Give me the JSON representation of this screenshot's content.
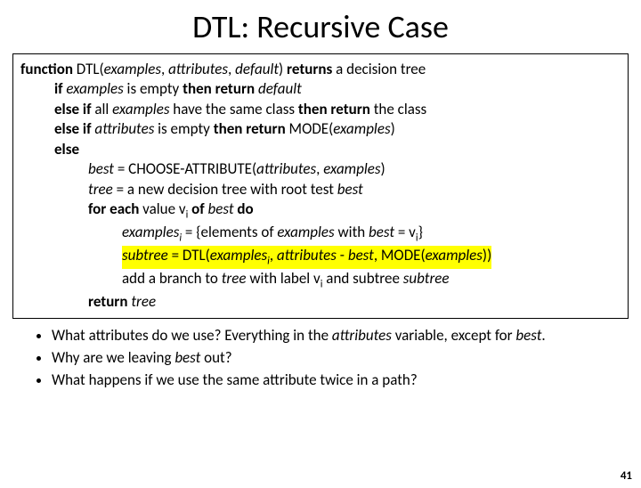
{
  "title": "DTL: Recursive Case",
  "algo": {
    "l1a": "function",
    "l1b": " DTL(",
    "l1c": "examples",
    "l1d": ", ",
    "l1e": "attributes",
    "l1f": ", ",
    "l1g": "default",
    "l1h": ") ",
    "l1i": "returns",
    "l1j": " a decision tree",
    "l2a": "if",
    "l2b": " ",
    "l2c": "examples",
    "l2d": " is empty ",
    "l2e": "then return",
    "l2f": " ",
    "l2g": "default",
    "l3a": "else if",
    "l3b": " all ",
    "l3c": "examples",
    "l3d": " have the same class ",
    "l3e": "then return",
    "l3f": " the class",
    "l4a": "else if",
    "l4b": " ",
    "l4c": "attributes",
    "l4d": " is empty ",
    "l4e": "then return",
    "l4f": " MODE(",
    "l4g": "examples",
    "l4h": ")",
    "l5a": "else",
    "l6a": "best",
    "l6b": " = CHOOSE-ATTRIBUTE(",
    "l6c": "attributes",
    "l6d": ", ",
    "l6e": "examples",
    "l6f": ")",
    "l7a": "tree",
    "l7b": " = a new decision tree with root test ",
    "l7c": "best",
    "l8a": "for each",
    "l8b": " value v",
    "l8c": " ",
    "l8d": "of",
    "l8e": " ",
    "l8f": "best",
    "l8g": " ",
    "l8h": "do",
    "l9a": "examples",
    "l9b": " = {elements of ",
    "l9c": "examples",
    "l9d": " with ",
    "l9e": "best",
    "l9f": " = v",
    "l9g": "}",
    "l10a": "subtree",
    "l10b": " = DTL(",
    "l10c": "examples",
    "l10d": ", ",
    "l10e": "attributes",
    "l10f": " - ",
    "l10g": "best",
    "l10h": ", MODE(",
    "l10i": "examples",
    "l10j": "))",
    "l11a": "add a branch to ",
    "l11b": "tree",
    "l11c": " with label v",
    "l11d": " and subtree ",
    "l11e": "subtree",
    "l12a": "return",
    "l12b": " ",
    "l12c": "tree"
  },
  "bullets": {
    "b1a": "What attributes do we use? Everything in the ",
    "b1b": "attributes",
    "b1c": " variable, except for ",
    "b1d": "best",
    "b1e": ".",
    "b2a": "Why are we leaving ",
    "b2b": "best",
    "b2c": " out?",
    "b3": "What happens if we use the same attribute twice in a path?"
  },
  "pagenum": "41"
}
